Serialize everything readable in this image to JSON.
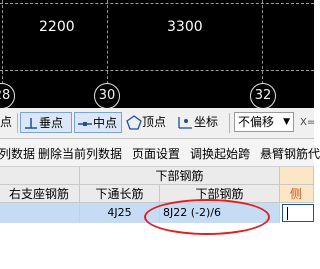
{
  "drawing": {
    "dimensions": [
      "2200",
      "3300"
    ],
    "axis_labels": [
      "28",
      "30",
      "32"
    ]
  },
  "snap_toolbar": {
    "vertex_partial": "点",
    "perpendicular": "垂点",
    "midpoint": "中点",
    "vertex": "顶点",
    "coordinate": "坐标",
    "offset_value": "不偏移",
    "x_partial": "X="
  },
  "menu": {
    "items": [
      "列数据",
      "删除当前列数据",
      "页面设置",
      "调换起始跨",
      "悬臂钢筋代"
    ]
  },
  "grid": {
    "group_header": "下部钢筋",
    "columns": [
      "右支座钢筋",
      "下通长筋",
      "下部钢筋",
      "侧面"
    ],
    "row": {
      "col2": "4J25",
      "col3": "8J22 (-2)/6"
    }
  },
  "colors": {
    "orange_header": "#d2541a",
    "selection_row": "#c6dcf5",
    "annotation": "#e02020"
  }
}
